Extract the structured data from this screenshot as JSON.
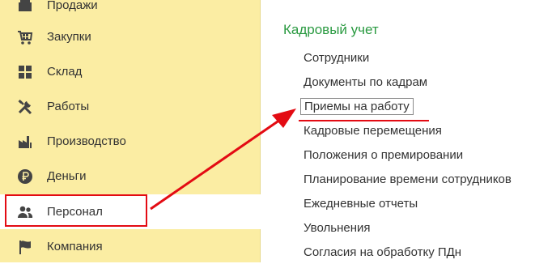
{
  "sidebar": {
    "items": [
      {
        "label": "Продажи",
        "icon": "sales-icon"
      },
      {
        "label": "Закупки",
        "icon": "purchases-icon"
      },
      {
        "label": "Склад",
        "icon": "warehouse-icon"
      },
      {
        "label": "Работы",
        "icon": "works-tools-icon"
      },
      {
        "label": "Производство",
        "icon": "factory-icon"
      },
      {
        "label": "Деньги",
        "icon": "ruble-icon"
      },
      {
        "label": "Персонал",
        "icon": "people-icon",
        "active": true
      },
      {
        "label": "Компания",
        "icon": "flag-icon"
      }
    ]
  },
  "section": {
    "title": "Кадровый учет",
    "links": [
      "Сотрудники",
      "Документы по кадрам",
      "Приемы на работу",
      "Кадровые перемещения",
      "Положения о премировании",
      "Планирование времени сотрудников",
      "Ежедневные отчеты",
      "Увольнения",
      "Согласия на обработку ПДн"
    ]
  },
  "colors": {
    "sidebar_bg": "#fbeda3",
    "section_title": "#2a9a41",
    "annotation_red": "#e30b13",
    "text": "#333333"
  }
}
